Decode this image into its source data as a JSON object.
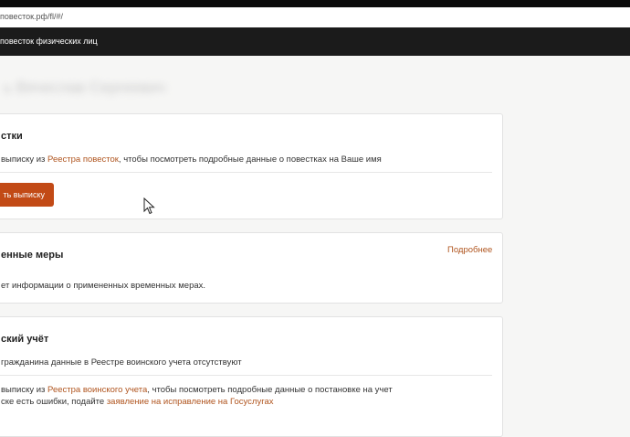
{
  "browser": {
    "url": "повесток.рф/fl/#/"
  },
  "navbar": {
    "brand": "повесток физических лиц"
  },
  "user": {
    "name": "ь Вячеслав Сергеевич"
  },
  "summons_card": {
    "title": "стки",
    "text_pre": "выписку из ",
    "link": "Реестра повесток",
    "text_post": ", чтобы посмотреть подробные данные о повестках на Ваше имя",
    "button_label": "ть выписку"
  },
  "measures_card": {
    "title": "енные меры",
    "more_link": "Подробнее",
    "text": "ет информации о примененных временных мерах."
  },
  "military_card": {
    "title": "ский учёт",
    "status_text": "гражданина данные в Реестре воинского учета отсутствуют",
    "text_pre": "выписку из ",
    "link": "Реестра воинского учета",
    "text_post": ",  чтобы посмотреть подробные данные о постановке на учет",
    "text2_pre": "ске есть ошибки, подайте ",
    "link2": "заявление на исправление на Госуслугах"
  }
}
